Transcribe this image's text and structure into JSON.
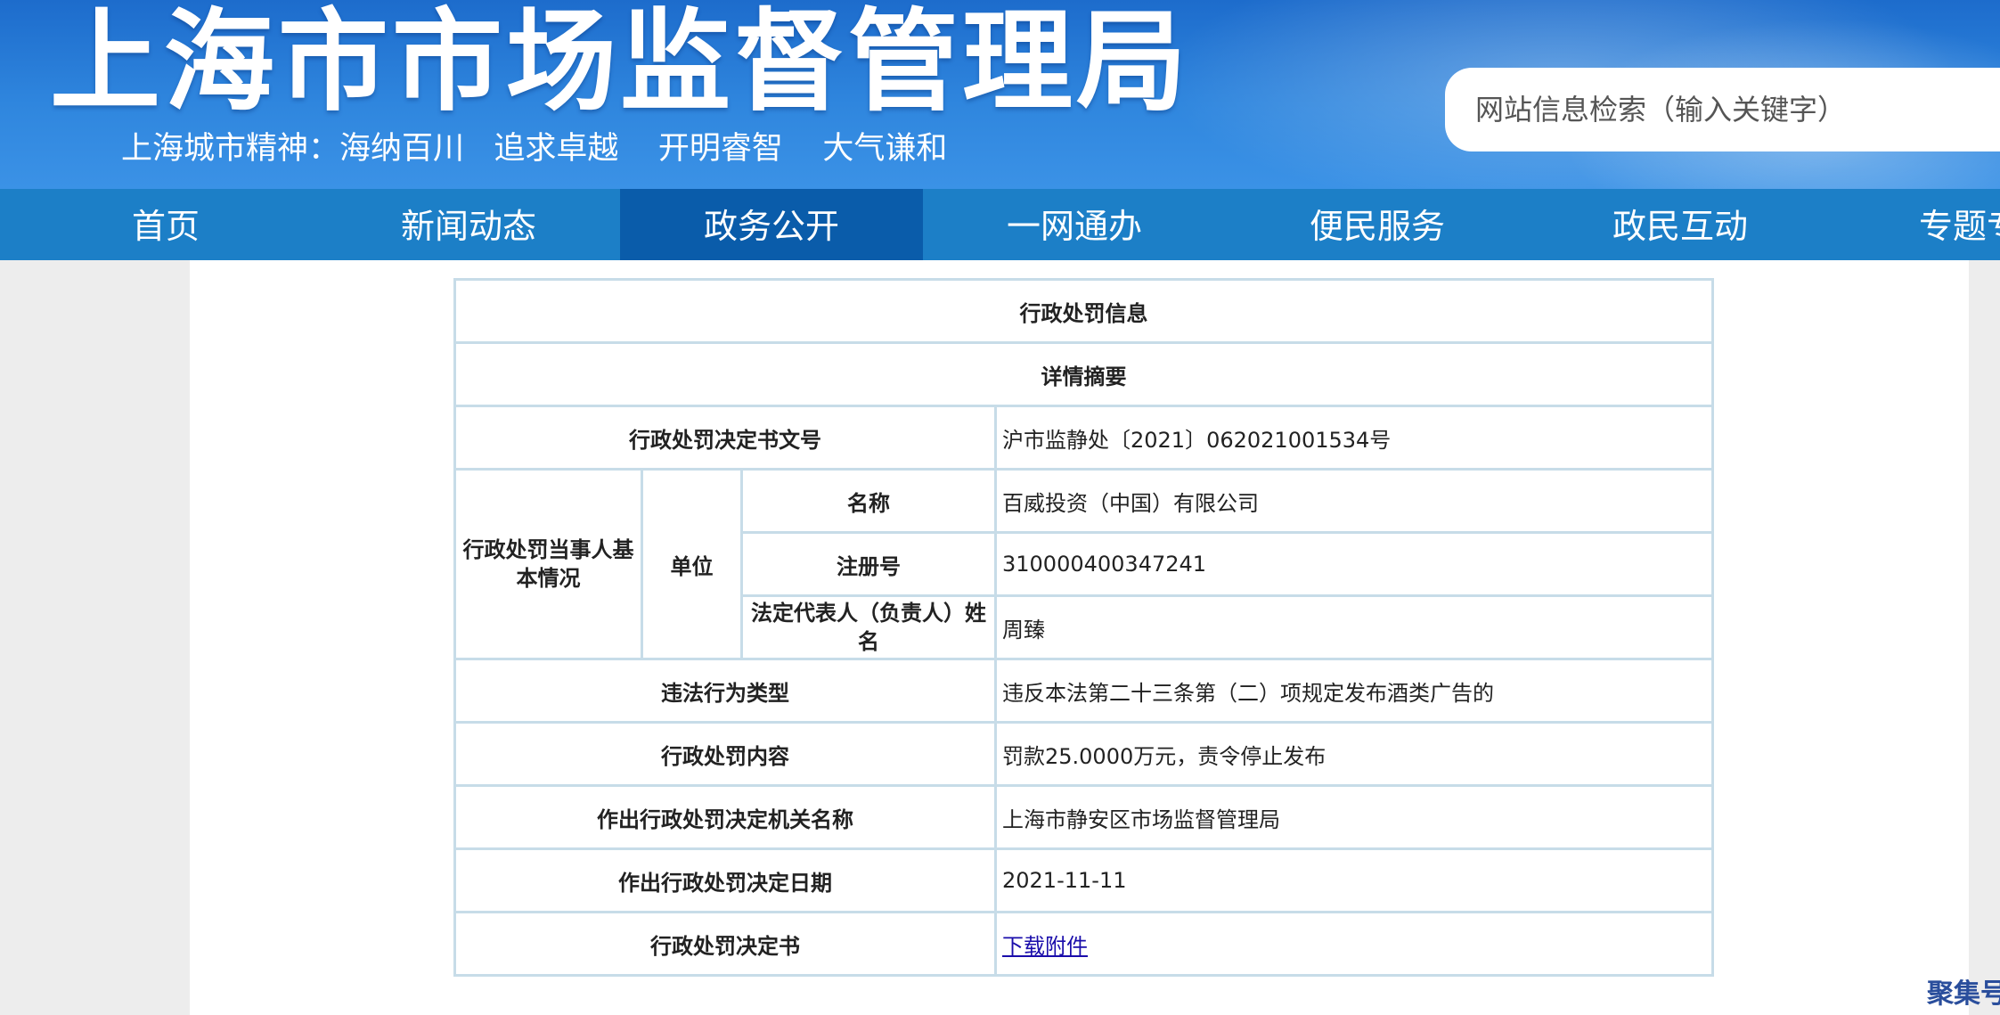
{
  "header": {
    "site_title": "上海市市场监督管理局",
    "slogan": "上海城市精神：海纳百川   追求卓越    开明睿智    大气谦和",
    "search_placeholder": "网站信息检索（输入关键字）"
  },
  "nav": {
    "items": [
      {
        "label": "首页"
      },
      {
        "label": "新闻动态"
      },
      {
        "label": "政务公开"
      },
      {
        "label": "一网通办"
      },
      {
        "label": "便民服务"
      },
      {
        "label": "政民互动"
      },
      {
        "label": "专题专"
      }
    ],
    "active_index": 2
  },
  "table": {
    "title": "行政处罚信息",
    "subtitle": "详情摘要",
    "doc_number_label": "行政处罚决定书文号",
    "doc_number_value": "沪市监静处〔2021〕062021001534号",
    "party_label": "行政处罚当事人基本情况",
    "unit_label": "单位",
    "name_label": "名称",
    "name_value": "百威投资（中国）有限公司",
    "reg_label": "注册号",
    "reg_value": "310000400347241",
    "rep_label": "法定代表人（负责人）姓名",
    "rep_value": "周臻",
    "violation_label": "违法行为类型",
    "violation_value": "违反本法第二十三条第（二）项规定发布酒类广告的",
    "content_label": "行政处罚内容",
    "content_value": "罚款25.0000万元，责令停止发布",
    "authority_label": "作出行政处罚决定机关名称",
    "authority_value": "上海市静安区市场监督管理局",
    "date_label": "作出行政处罚决定日期",
    "date_value": "2021-11-11",
    "decision_label": "行政处罚决定书",
    "decision_link": "下载附件"
  },
  "footer_widget": {
    "label": "聚集号"
  },
  "colors": {
    "header_blue": "#2f86de",
    "nav_blue": "#1c7fc7",
    "nav_active": "#0a5caa",
    "table_border": "#c7dce8",
    "link": "#1a0dab"
  }
}
